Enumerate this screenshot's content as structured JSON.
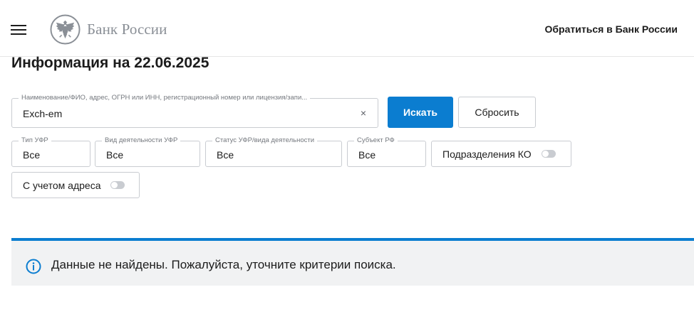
{
  "header": {
    "logo_text": "Банк России",
    "contact_link": "Обратиться в Банк России"
  },
  "page": {
    "title": "Информация на 22.06.2025"
  },
  "search": {
    "label": "Наименование/ФИО, адрес, ОГРН или ИНН, регистрационный номер или лицензия/запи...",
    "value": "Exch-em",
    "clear_icon": "close-icon",
    "clear_glyph": "×",
    "submit_label": "Искать",
    "reset_label": "Сбросить"
  },
  "filters": [
    {
      "label": "Тип УФР",
      "value": "Все"
    },
    {
      "label": "Вид деятельности УФР",
      "value": "Все"
    },
    {
      "label": "Статус УФР/вида деятельности",
      "value": "Все"
    },
    {
      "label": "Субъект РФ",
      "value": "Все"
    }
  ],
  "toggles": [
    {
      "label": "Подразделения КО",
      "on": false
    },
    {
      "label": "С учетом адреса",
      "on": false
    }
  ],
  "alert": {
    "icon": "info-icon",
    "message": "Данные не найдены. Пожалуйста, уточните критерии поиска."
  },
  "colors": {
    "accent": "#0b7dd0",
    "logo_gray": "#8a8f96",
    "alert_bg": "#f1f2f3",
    "border": "#c9ccd1"
  }
}
